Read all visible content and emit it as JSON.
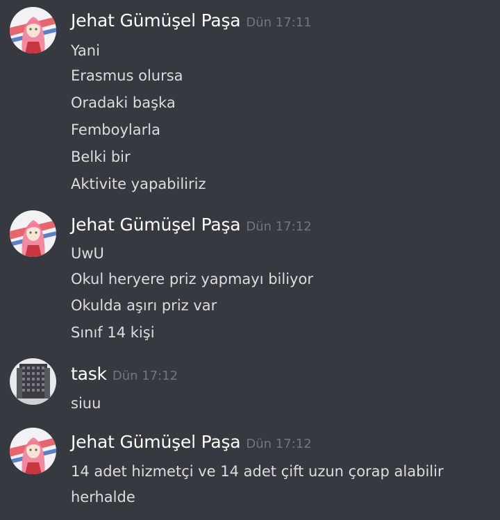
{
  "colors": {
    "background": "#36393f",
    "username": "#ffffff",
    "timestamp": "#72767d",
    "message_text": "#dcddde"
  },
  "messages": [
    {
      "author": "Jehat Gümüşel Paşa",
      "timestamp": "Dün 17:11",
      "avatar_icon": "anime-girl-avatar",
      "lines": [
        "Yani",
        "Erasmus olursa",
        "Oradaki başka",
        "Femboylarla",
        "Belki bir",
        "Aktivite yapabiliriz"
      ]
    },
    {
      "author": "Jehat Gümüşel Paşa",
      "timestamp": "Dün 17:12",
      "avatar_icon": "anime-girl-avatar",
      "lines": [
        "UwU",
        "Okul heryere priz yapmayı biliyor",
        "Okulda aşırı priz var",
        "Sınıf 14 kişi"
      ]
    },
    {
      "author": "task",
      "timestamp": "Dün 17:12",
      "avatar_icon": "building-avatar",
      "lines": [
        "siuu"
      ]
    },
    {
      "author": "Jehat Gümüşel Paşa",
      "timestamp": "Dün 17:12",
      "avatar_icon": "anime-girl-avatar",
      "lines": [
        "14 adet hizmetçi ve 14 adet çift uzun çorap alabilir herhalde"
      ]
    }
  ]
}
